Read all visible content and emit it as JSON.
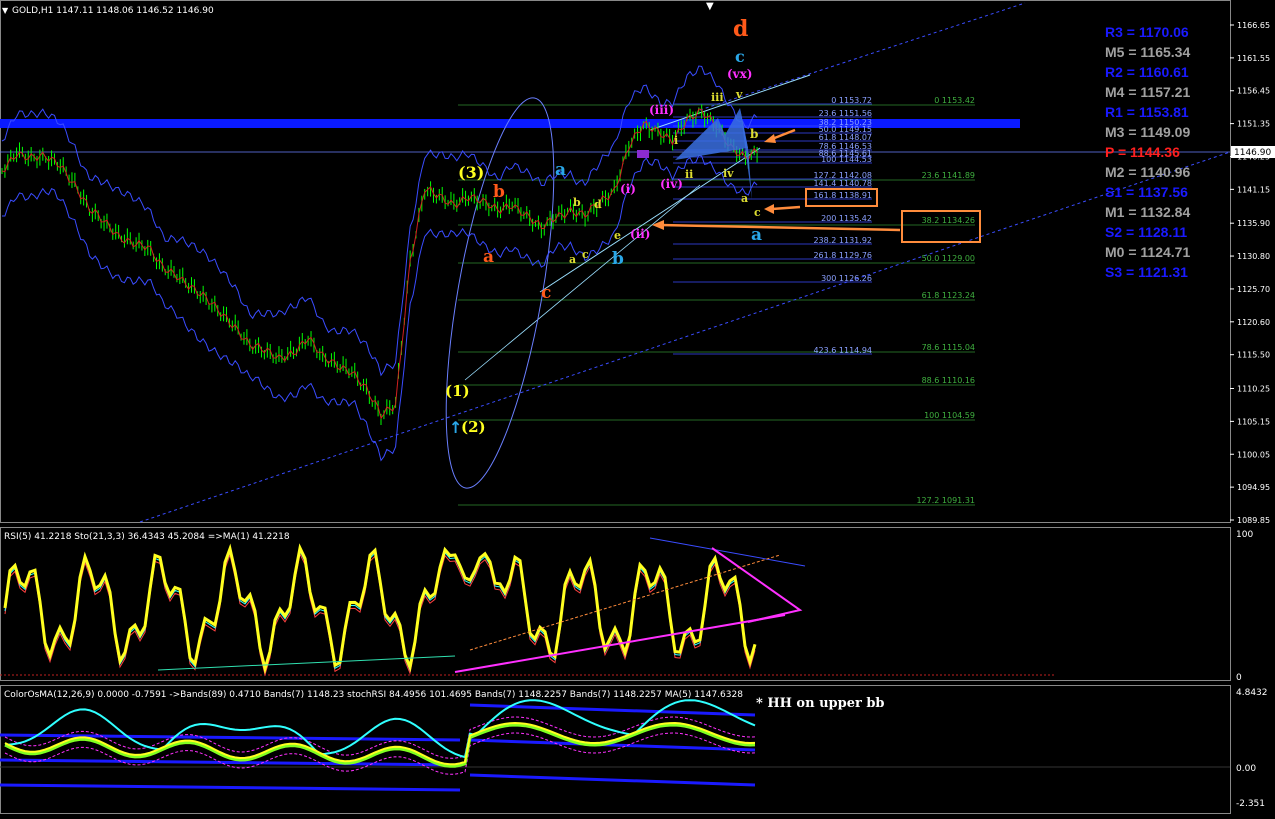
{
  "header": {
    "main": "GOLD,H1  1147.11 1148.06 1146.52 1146.90",
    "rsi": "RSI(5) 41.2218  Sto(21,3,3) 36.4343 45.2084  =>MA(1) 41.2218",
    "osma": "ColorOsMA(12,26,9) 0.0000 -0.7591  ->Bands(89) 0.4710  Bands(7) 1148.23  stochRSI 84.4956 101.4695  Bands(7) 1148.2257  Bands(7) 1148.2257  MA(5) 1147.6328"
  },
  "price_axis": {
    "ticks": [
      "1166.65",
      "1161.55",
      "1156.45",
      "1151.35",
      "1146.25",
      "1141.15",
      "1135.90",
      "1130.80",
      "1125.70",
      "1120.60",
      "1115.50",
      "1110.25",
      "1105.15",
      "1100.05",
      "1094.95",
      "1089.85"
    ],
    "current_price": "1146.90"
  },
  "rsi_axis": {
    "top": "100",
    "bottom": "0"
  },
  "osma_axis": {
    "top": "4.8432",
    "mid": "0.00",
    "bottom": "-2.351"
  },
  "pivots": [
    {
      "label": "R3 = 1170.06",
      "color": "#1a1aff"
    },
    {
      "label": "M5 = 1165.34",
      "color": "#a0a0a0"
    },
    {
      "label": "R2 = 1160.61",
      "color": "#1a1aff"
    },
    {
      "label": "M4 = 1157.21",
      "color": "#a0a0a0"
    },
    {
      "label": "R1 = 1153.81",
      "color": "#1a1aff"
    },
    {
      "label": "M3 = 1149.09",
      "color": "#a0a0a0"
    },
    {
      "label": "P  = 1144.36",
      "color": "#ff2020"
    },
    {
      "label": "M2 = 1140.96",
      "color": "#a0a0a0"
    },
    {
      "label": "S1 = 1137.56",
      "color": "#1a1aff"
    },
    {
      "label": "M1 = 1132.84",
      "color": "#a0a0a0"
    },
    {
      "label": "S2 = 1128.11",
      "color": "#1a1aff"
    },
    {
      "label": "M0 = 1124.71",
      "color": "#a0a0a0"
    },
    {
      "label": "S3 = 1121.31",
      "color": "#1a1aff"
    }
  ],
  "fib_right": [
    "0 1153.42",
    "23.6 1141.89",
    "38.2 1134.26",
    "50.0 1129.00",
    "61.8 1123.24",
    "78.6 1115.04",
    "88.6 1110.16",
    "100 1104.59",
    "127.2 1091.31"
  ],
  "fib_left": [
    "0 1153.72",
    "23.6 1151.56",
    "38.2 1150.23",
    "50.0 1149.15",
    "61.8 1148.07",
    "78.6 1146.53",
    "88.6 1145.61",
    "100 1144.53",
    "127.2 1142.08",
    "141.4 1140.78",
    "161.8 1138.91",
    "200 1135.42",
    "238.2 1131.92",
    "261.8 1129.76",
    "300 1126.26",
    "423.6 1114.94"
  ],
  "wave_labels": {
    "d": "d",
    "c_top": "c",
    "vx": "(vx)",
    "v": "v",
    "iii": "iii",
    "iii_p": "(iii)",
    "i_small": "i",
    "ii": "ii",
    "iv": "iv",
    "iv_p": "(iv)",
    "i_p": "(i)",
    "ii_p": "(ii)",
    "b_small": "b",
    "a_small": "a",
    "c_small": "c",
    "a_blue": "a",
    "a_blue2": "a",
    "w3": "(3)",
    "b_orange": "b",
    "a_orange": "a",
    "c_orange": "c",
    "b_blue": "b",
    "ax": "a",
    "bx": "b",
    "cx": "c",
    "dx": "d",
    "ex": "e",
    "w1": "(1)",
    "w2": "(2)"
  },
  "annotation": "* HH on upper bb",
  "colors": {
    "candle": "#00ff00",
    "bb": "#3a4cff",
    "blue_band": "#0a1aff",
    "orange": "#ff8c3c",
    "magenta": "#ff30ff",
    "yellow": "#ffff20",
    "cyan": "#30ffff"
  },
  "chart_data": [
    {
      "type": "candlestick",
      "title": "GOLD,H1",
      "ylim": [
        1089.85,
        1166.65
      ],
      "x": "hourly bars",
      "close_path": [
        1144,
        1147,
        1146,
        1146,
        1145,
        1142,
        1138,
        1136,
        1134,
        1133,
        1132,
        1129,
        1128,
        1126,
        1124,
        1122,
        1120,
        1117,
        1116,
        1115,
        1116,
        1118,
        1115,
        1114,
        1113,
        1110,
        1106,
        1108,
        1130,
        1141,
        1140,
        1139,
        1140,
        1139,
        1138,
        1139,
        1137,
        1135,
        1137,
        1138,
        1137,
        1139,
        1141,
        1148,
        1151,
        1150,
        1149,
        1152,
        1153,
        1151,
        1148,
        1146,
        1147
      ]
    },
    {
      "type": "line",
      "title": "RSI(5) / Sto(21,3,3)",
      "ylim": [
        0,
        100
      ]
    },
    {
      "type": "line",
      "title": "ColorOsMA(12,26,9)",
      "ylim": [
        -2.351,
        4.8432
      ]
    }
  ]
}
